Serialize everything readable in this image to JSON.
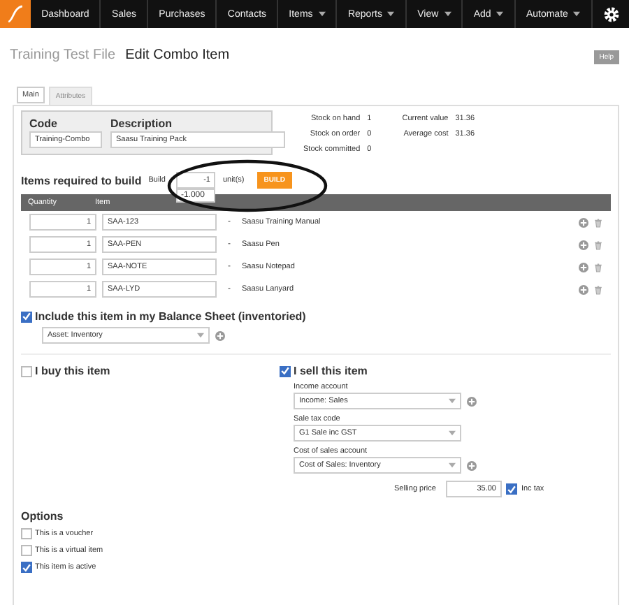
{
  "nav": {
    "items": [
      {
        "label": "Dashboard",
        "has_menu": false
      },
      {
        "label": "Sales",
        "has_menu": false
      },
      {
        "label": "Purchases",
        "has_menu": false
      },
      {
        "label": "Contacts",
        "has_menu": false
      },
      {
        "label": "Items",
        "has_menu": true
      },
      {
        "label": "Reports",
        "has_menu": true
      },
      {
        "label": "View",
        "has_menu": true
      },
      {
        "label": "Add",
        "has_menu": true
      },
      {
        "label": "Automate",
        "has_menu": true
      }
    ]
  },
  "header": {
    "file": "Training Test File",
    "title": "Edit Combo Item",
    "help": "Help"
  },
  "tabs": [
    {
      "label": "Main",
      "selected": true
    },
    {
      "label": "Attributes",
      "selected": false
    }
  ],
  "code": {
    "label": "Code",
    "value": "Training-Combo"
  },
  "description": {
    "label": "Description",
    "value": "Saasu Training Pack"
  },
  "stats": [
    [
      {
        "label": "Stock on hand",
        "value": "1"
      },
      {
        "label": "Stock on order",
        "value": "0"
      },
      {
        "label": "Stock committed",
        "value": "0"
      }
    ],
    [
      {
        "label": "Current value",
        "value": "31.36"
      },
      {
        "label": "Average cost",
        "value": "31.36"
      }
    ]
  ],
  "build": {
    "heading": "Items required to build",
    "label": "Build",
    "value": "-1",
    "suggestion": "-1.000",
    "unit": "unit(s)",
    "button": "BUILD"
  },
  "table": {
    "columns": [
      "Quantity",
      "Item"
    ],
    "rows": [
      {
        "quantity": "1",
        "code": "SAA-123",
        "separator": "-",
        "name": "Saasu Training Manual"
      },
      {
        "quantity": "1",
        "code": "SAA-PEN",
        "separator": "-",
        "name": "Saasu Pen"
      },
      {
        "quantity": "1",
        "code": "SAA-NOTE",
        "separator": "-",
        "name": "Saasu Notepad"
      },
      {
        "quantity": "1",
        "code": "SAA-LYD",
        "separator": "-",
        "name": "Saasu Lanyard"
      }
    ]
  },
  "balance_sheet": {
    "checked": true,
    "label": "Include this item in my Balance Sheet (inventoried)",
    "account": "Asset: Inventory"
  },
  "buy": {
    "checked": false,
    "label": "I buy this item"
  },
  "sell": {
    "checked": true,
    "label": "I sell this item",
    "fields": [
      {
        "label": "Income account",
        "value": "Income: Sales",
        "addable": true
      },
      {
        "label": "Sale tax code",
        "value": "G1 Sale inc GST",
        "addable": false
      },
      {
        "label": "Cost of sales account",
        "value": "Cost of Sales: Inventory",
        "addable": true
      }
    ],
    "price_label": "Selling price",
    "price": "35.00",
    "inc_tax": {
      "checked": true,
      "label": "Inc tax"
    }
  },
  "options": {
    "heading": "Options",
    "items": [
      {
        "label": "This is a voucher",
        "checked": false
      },
      {
        "label": "This is a virtual item",
        "checked": false
      },
      {
        "label": "This item is active",
        "checked": true
      }
    ]
  }
}
